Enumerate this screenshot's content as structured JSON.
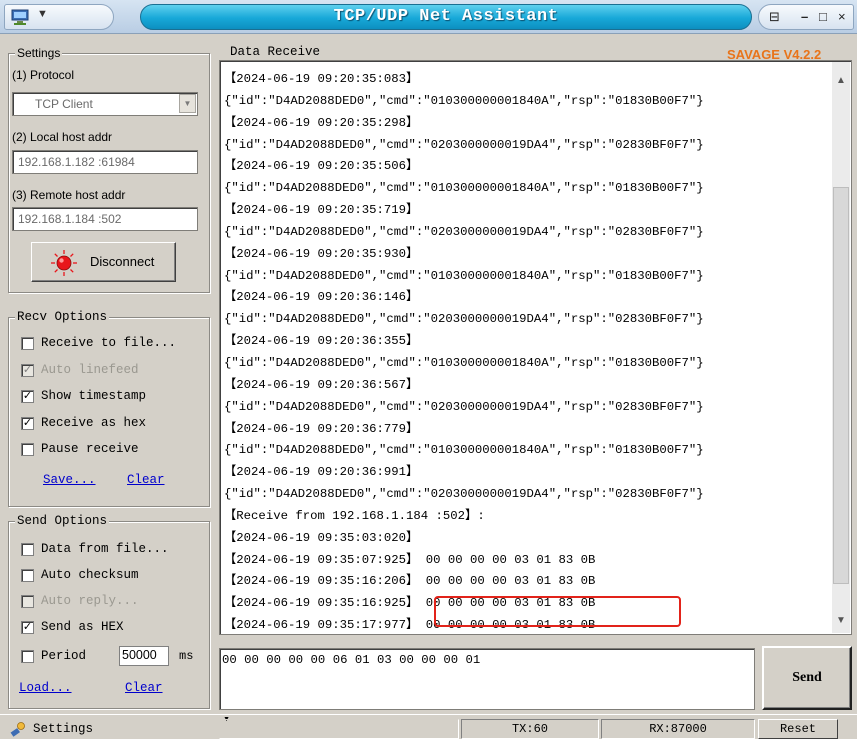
{
  "window": {
    "title": "TCP/UDP Net Assistant",
    "version": "SAVAGE V4.2.2",
    "controls": {
      "pin": "⊟",
      "minimize": "–",
      "maximize": "□",
      "close": "×"
    },
    "sys_menu_arrow": "▼"
  },
  "settings": {
    "legend": "Settings",
    "protocol_label": "(1) Protocol",
    "protocol_value": "TCP Client",
    "local_label": "(2) Local host addr",
    "local_value": "192.168.1.182 :61984",
    "remote_label": "(3) Remote host addr",
    "remote_value": "192.168.1.184 :502",
    "connect_button": "Disconnect",
    "connect_indicator_color": "#e8161b"
  },
  "recv_options": {
    "legend": "Recv Options",
    "items": [
      {
        "label": "Receive to file...",
        "checked": "",
        "enabled": true
      },
      {
        "label": "Auto linefeed",
        "checked": "✓",
        "enabled": false
      },
      {
        "label": "Show timestamp",
        "checked": "✓",
        "enabled": true
      },
      {
        "label": "Receive as hex",
        "checked": "✓",
        "enabled": true
      },
      {
        "label": "Pause receive",
        "checked": "",
        "enabled": true
      }
    ],
    "save_link": "Save...",
    "clear_link": "Clear"
  },
  "send_options": {
    "legend": "Send Options",
    "items": [
      {
        "label": "Data from file...",
        "checked": "",
        "enabled": true
      },
      {
        "label": "Auto checksum",
        "checked": "",
        "enabled": true
      },
      {
        "label": "Auto reply...",
        "checked": "",
        "enabled": false
      },
      {
        "label": "Send as HEX",
        "checked": "✓",
        "enabled": true
      }
    ],
    "period_label": "Period",
    "period_value": "50000",
    "period_unit": "ms",
    "load_link": "Load...",
    "clear_link": "Clear"
  },
  "receive": {
    "legend": "Data Receive",
    "lines": [
      "【2024-06-19 09:20:35:083】",
      "{\"id\":\"D4AD2088DED0\",\"cmd\":\"010300000001840A\",\"rsp\":\"01830B00F7\"}",
      "【2024-06-19 09:20:35:298】",
      "{\"id\":\"D4AD2088DED0\",\"cmd\":\"0203000000019DA4\",\"rsp\":\"02830BF0F7\"}",
      "【2024-06-19 09:20:35:506】",
      "{\"id\":\"D4AD2088DED0\",\"cmd\":\"010300000001840A\",\"rsp\":\"01830B00F7\"}",
      "【2024-06-19 09:20:35:719】",
      "{\"id\":\"D4AD2088DED0\",\"cmd\":\"0203000000019DA4\",\"rsp\":\"02830BF0F7\"}",
      "【2024-06-19 09:20:35:930】",
      "{\"id\":\"D4AD2088DED0\",\"cmd\":\"010300000001840A\",\"rsp\":\"01830B00F7\"}",
      "【2024-06-19 09:20:36:146】",
      "{\"id\":\"D4AD2088DED0\",\"cmd\":\"0203000000019DA4\",\"rsp\":\"02830BF0F7\"}",
      "【2024-06-19 09:20:36:355】",
      "{\"id\":\"D4AD2088DED0\",\"cmd\":\"010300000001840A\",\"rsp\":\"01830B00F7\"}",
      "【2024-06-19 09:20:36:567】",
      "{\"id\":\"D4AD2088DED0\",\"cmd\":\"0203000000019DA4\",\"rsp\":\"02830BF0F7\"}",
      "【2024-06-19 09:20:36:779】",
      "{\"id\":\"D4AD2088DED0\",\"cmd\":\"010300000001840A\",\"rsp\":\"01830B00F7\"}",
      "【2024-06-19 09:20:36:991】",
      "{\"id\":\"D4AD2088DED0\",\"cmd\":\"0203000000019DA4\",\"rsp\":\"02830BF0F7\"}",
      "【Receive from 192.168.1.184 :502】:",
      "【2024-06-19 09:35:03:020】",
      "【2024-06-19 09:35:07:925】 00 00 00 00 03 01 83 0B",
      "【2024-06-19 09:35:16:206】 00 00 00 00 03 01 83 0B",
      "【2024-06-19 09:35:16:925】 00 00 00 00 03 01 83 0B",
      "【2024-06-19 09:35:17:977】 00 00 00 00 03 01 83 0B"
    ],
    "scroll_up": "▲",
    "scroll_down": "▼",
    "highlight_color": "#e2231a"
  },
  "send": {
    "text": "00 00 00 00 00 06 01 03 00 00 00 01",
    "button": "Send"
  },
  "status": {
    "settings_label": "Settings",
    "tx": "TX:60",
    "rx": "RX:87000",
    "reset": "Reset",
    "caret": "▲"
  }
}
